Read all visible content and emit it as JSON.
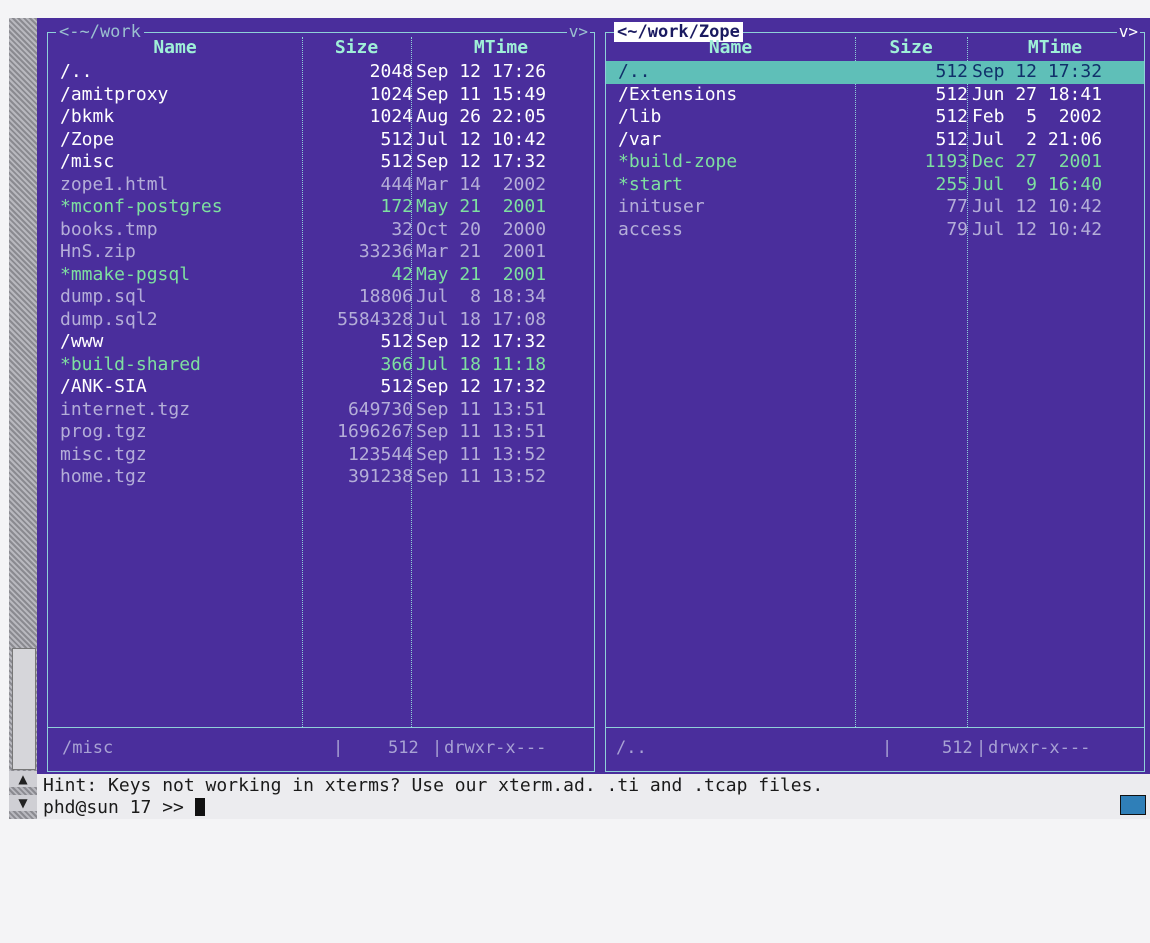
{
  "left_panel": {
    "title": "<-~/work",
    "corner": "v>",
    "headers": {
      "name": "Name",
      "size": "Size",
      "mtime": "MTime"
    },
    "rows": [
      {
        "name": "/..",
        "size": "2048",
        "mtime": "Sep 12 17:26",
        "kind": "dir"
      },
      {
        "name": "/amitproxy",
        "size": "1024",
        "mtime": "Sep 11 15:49",
        "kind": "dir"
      },
      {
        "name": "/bkmk",
        "size": "1024",
        "mtime": "Aug 26 22:05",
        "kind": "dir"
      },
      {
        "name": "/Zope",
        "size": "512",
        "mtime": "Jul 12 10:42",
        "kind": "dir"
      },
      {
        "name": "/misc",
        "size": "512",
        "mtime": "Sep 12 17:32",
        "kind": "dir"
      },
      {
        "name": "zope1.html",
        "size": "444",
        "mtime": "Mar 14  2002",
        "kind": "file"
      },
      {
        "name": "*mconf-postgres",
        "size": "172",
        "mtime": "May 21  2001",
        "kind": "exec"
      },
      {
        "name": "books.tmp",
        "size": "32",
        "mtime": "Oct 20  2000",
        "kind": "file"
      },
      {
        "name": "HnS.zip",
        "size": "33236",
        "mtime": "Mar 21  2001",
        "kind": "file"
      },
      {
        "name": "*mmake-pgsql",
        "size": "42",
        "mtime": "May 21  2001",
        "kind": "exec"
      },
      {
        "name": "dump.sql",
        "size": "18806",
        "mtime": "Jul  8 18:34",
        "kind": "file"
      },
      {
        "name": "dump.sql2",
        "size": "5584328",
        "mtime": "Jul 18 17:08",
        "kind": "file"
      },
      {
        "name": "/www",
        "size": "512",
        "mtime": "Sep 12 17:32",
        "kind": "dir"
      },
      {
        "name": "*build-shared",
        "size": "366",
        "mtime": "Jul 18 11:18",
        "kind": "exec"
      },
      {
        "name": "/ANK-SIA",
        "size": "512",
        "mtime": "Sep 12 17:32",
        "kind": "dir"
      },
      {
        "name": "internet.tgz",
        "size": "649730",
        "mtime": "Sep 11 13:51",
        "kind": "file"
      },
      {
        "name": "prog.tgz",
        "size": "1696267",
        "mtime": "Sep 11 13:51",
        "kind": "file"
      },
      {
        "name": "misc.tgz",
        "size": "123544",
        "mtime": "Sep 11 13:52",
        "kind": "file"
      },
      {
        "name": "home.tgz",
        "size": "391238",
        "mtime": "Sep 11 13:52",
        "kind": "file"
      }
    ],
    "status": {
      "name": "/misc",
      "size": "512",
      "perm": "drwxr-x---"
    }
  },
  "right_panel": {
    "title": "~/work/Zope",
    "title_prefix": "<",
    "corner": "v>",
    "headers": {
      "name": "Name",
      "size": "Size",
      "mtime": "MTime"
    },
    "rows": [
      {
        "name": "/..",
        "size": "512",
        "mtime": "Sep 12 17:32",
        "kind": "dir",
        "selected": true
      },
      {
        "name": "/Extensions",
        "size": "512",
        "mtime": "Jun 27 18:41",
        "kind": "dir"
      },
      {
        "name": "/lib",
        "size": "512",
        "mtime": "Feb  5  2002",
        "kind": "dir"
      },
      {
        "name": "/var",
        "size": "512",
        "mtime": "Jul  2 21:06",
        "kind": "dir"
      },
      {
        "name": "*build-zope",
        "size": "1193",
        "mtime": "Dec 27  2001",
        "kind": "exec"
      },
      {
        "name": "*start",
        "size": "255",
        "mtime": "Jul  9 16:40",
        "kind": "exec"
      },
      {
        "name": "inituser",
        "size": "77",
        "mtime": "Jul 12 10:42",
        "kind": "file"
      },
      {
        "name": "access",
        "size": "79",
        "mtime": "Jul 12 10:42",
        "kind": "file"
      }
    ],
    "status": {
      "name": "/..",
      "size": "512",
      "perm": "drwxr-x---"
    }
  },
  "hint": "Hint: Keys not working in xterms? Use our xterm.ad. .ti and .tcap files.",
  "prompt": "phd@sun 17 >> ",
  "colors": {
    "background": "#4a2e9c",
    "dir": "#ffffff",
    "file": "#b4aed8",
    "exec": "#7ee0a0",
    "selected": "#5fbfb8"
  },
  "icons": {
    "scroll_up": "triangle-up-icon",
    "scroll_down": "triangle-down-icon"
  }
}
